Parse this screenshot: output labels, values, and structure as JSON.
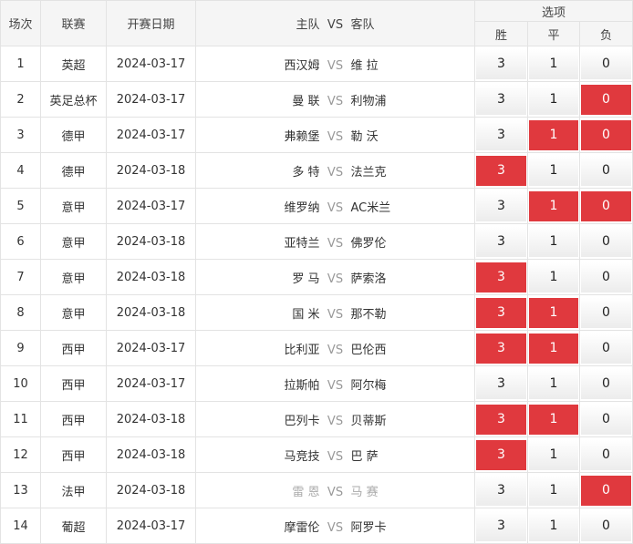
{
  "headers": {
    "round": "场次",
    "league": "联赛",
    "date": "开赛日期",
    "home": "主队",
    "vs": "VS",
    "away": "客队",
    "options": "选项",
    "win": "胜",
    "draw": "平",
    "lose": "负"
  },
  "option_values": {
    "win": "3",
    "draw": "1",
    "lose": "0"
  },
  "colors": {
    "selected": "#e0393e",
    "header_bg": "#f5f5f5",
    "border": "#e3e3e3"
  },
  "matches": [
    {
      "no": "1",
      "league": "英超",
      "date": "2024-03-17",
      "home": "西汉姆",
      "vs": "VS",
      "away": "维 拉",
      "muted": false,
      "selected": []
    },
    {
      "no": "2",
      "league": "英足总杯",
      "date": "2024-03-17",
      "home": "曼 联",
      "vs": "VS",
      "away": "利物浦",
      "muted": false,
      "selected": [
        "lose"
      ]
    },
    {
      "no": "3",
      "league": "德甲",
      "date": "2024-03-17",
      "home": "弗赖堡",
      "vs": "VS",
      "away": "勒 沃",
      "muted": false,
      "selected": [
        "draw",
        "lose"
      ]
    },
    {
      "no": "4",
      "league": "德甲",
      "date": "2024-03-18",
      "home": "多 特",
      "vs": "VS",
      "away": "法兰克",
      "muted": false,
      "selected": [
        "win"
      ]
    },
    {
      "no": "5",
      "league": "意甲",
      "date": "2024-03-17",
      "home": "维罗纳",
      "vs": "VS",
      "away": "AC米兰",
      "muted": false,
      "selected": [
        "draw",
        "lose"
      ]
    },
    {
      "no": "6",
      "league": "意甲",
      "date": "2024-03-18",
      "home": "亚特兰",
      "vs": "VS",
      "away": "佛罗伦",
      "muted": false,
      "selected": []
    },
    {
      "no": "7",
      "league": "意甲",
      "date": "2024-03-18",
      "home": "罗 马",
      "vs": "VS",
      "away": "萨索洛",
      "muted": false,
      "selected": [
        "win"
      ]
    },
    {
      "no": "8",
      "league": "意甲",
      "date": "2024-03-18",
      "home": "国 米",
      "vs": "VS",
      "away": "那不勒",
      "muted": false,
      "selected": [
        "win",
        "draw"
      ]
    },
    {
      "no": "9",
      "league": "西甲",
      "date": "2024-03-17",
      "home": "比利亚",
      "vs": "VS",
      "away": "巴伦西",
      "muted": false,
      "selected": [
        "win",
        "draw"
      ]
    },
    {
      "no": "10",
      "league": "西甲",
      "date": "2024-03-17",
      "home": "拉斯帕",
      "vs": "VS",
      "away": "阿尔梅",
      "muted": false,
      "selected": []
    },
    {
      "no": "11",
      "league": "西甲",
      "date": "2024-03-18",
      "home": "巴列卡",
      "vs": "VS",
      "away": "贝蒂斯",
      "muted": false,
      "selected": [
        "win",
        "draw"
      ]
    },
    {
      "no": "12",
      "league": "西甲",
      "date": "2024-03-18",
      "home": "马竞技",
      "vs": "VS",
      "away": "巴 萨",
      "muted": false,
      "selected": [
        "win"
      ]
    },
    {
      "no": "13",
      "league": "法甲",
      "date": "2024-03-18",
      "home": "雷 恩",
      "vs": "VS",
      "away": "马 赛",
      "muted": true,
      "selected": [
        "lose"
      ]
    },
    {
      "no": "14",
      "league": "葡超",
      "date": "2024-03-17",
      "home": "摩雷伦",
      "vs": "VS",
      "away": "阿罗卡",
      "muted": false,
      "selected": []
    }
  ]
}
